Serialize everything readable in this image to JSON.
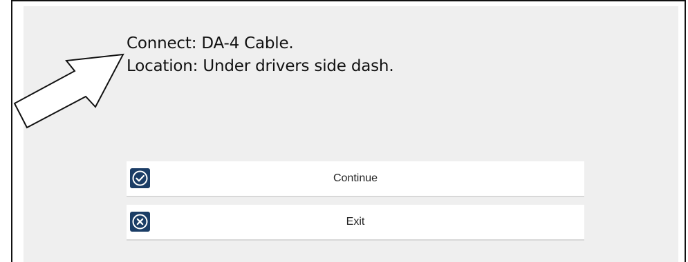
{
  "instructions": {
    "connect": "Connect: DA-4 Cable.",
    "location": "Location: Under drivers side dash."
  },
  "buttons": {
    "continue_label": "Continue",
    "exit_label": "Exit"
  },
  "icons": {
    "continue": "check-circle-icon",
    "exit": "x-circle-icon",
    "pointer": "arrow-pointer-icon"
  },
  "colors": {
    "panel_bg": "#efefef",
    "icon_bg": "#1b3d66",
    "frame_border": "#111111"
  }
}
